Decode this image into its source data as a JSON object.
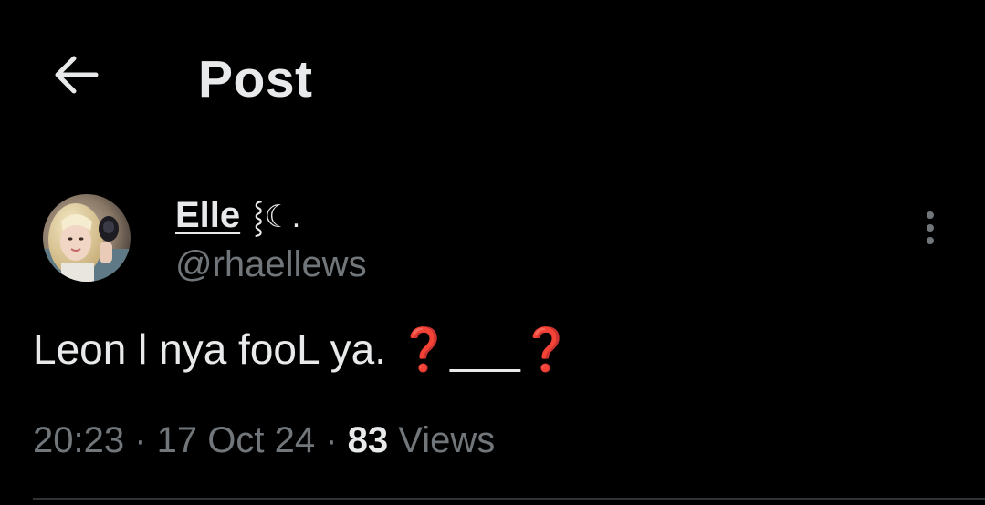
{
  "header": {
    "title": "Post",
    "back_icon": "arrow-left-icon"
  },
  "post": {
    "author": {
      "display_name": "Elle",
      "name_decoration": "⸾☾.",
      "handle": "@rhaellews",
      "avatar_icon": "avatar"
    },
    "more_icon": "more-vertical-icon",
    "text": {
      "part1": "Leon l nya fooL ya. ",
      "qmark1": "❓",
      "part2": "___",
      "qmark2": "❓"
    },
    "meta": {
      "time": "20:23",
      "separator1": " · ",
      "date": "17 Oct 24",
      "separator2": " · ",
      "views_count": "83",
      "views_label": " Views"
    }
  },
  "colors": {
    "background": "#000000",
    "text_primary": "#e7e9ea",
    "text_secondary": "#71767b",
    "divider": "#2f3336",
    "question_mark": "#dd2e44"
  }
}
